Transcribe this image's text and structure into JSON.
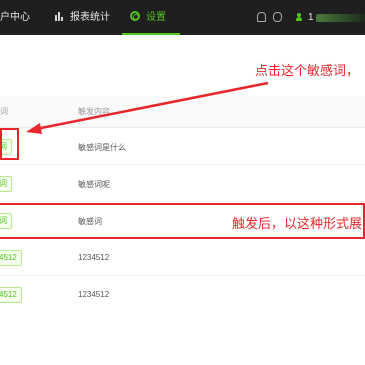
{
  "nav": {
    "first_label": "户中心",
    "reports_label": "报表统计",
    "settings_label": "设置",
    "user_initial": "1"
  },
  "table": {
    "headers": {
      "word": "词",
      "content": "触发内容"
    },
    "rows": [
      {
        "tag": "词",
        "content": "敏感词是什么"
      },
      {
        "tag": "词",
        "content": "敏感词呢"
      },
      {
        "tag": "词",
        "content": "敏感词"
      },
      {
        "tag": "4512",
        "content": "1234512"
      },
      {
        "tag": "4512",
        "content": "1234512"
      }
    ]
  },
  "annotations": {
    "click_hint": "点击这个敏感词，",
    "triggered_hint": "触发后，以这种形式展"
  },
  "colors": {
    "accent": "#52c41a",
    "annotation": "#e8262c",
    "topbar": "#1f1f1f"
  }
}
